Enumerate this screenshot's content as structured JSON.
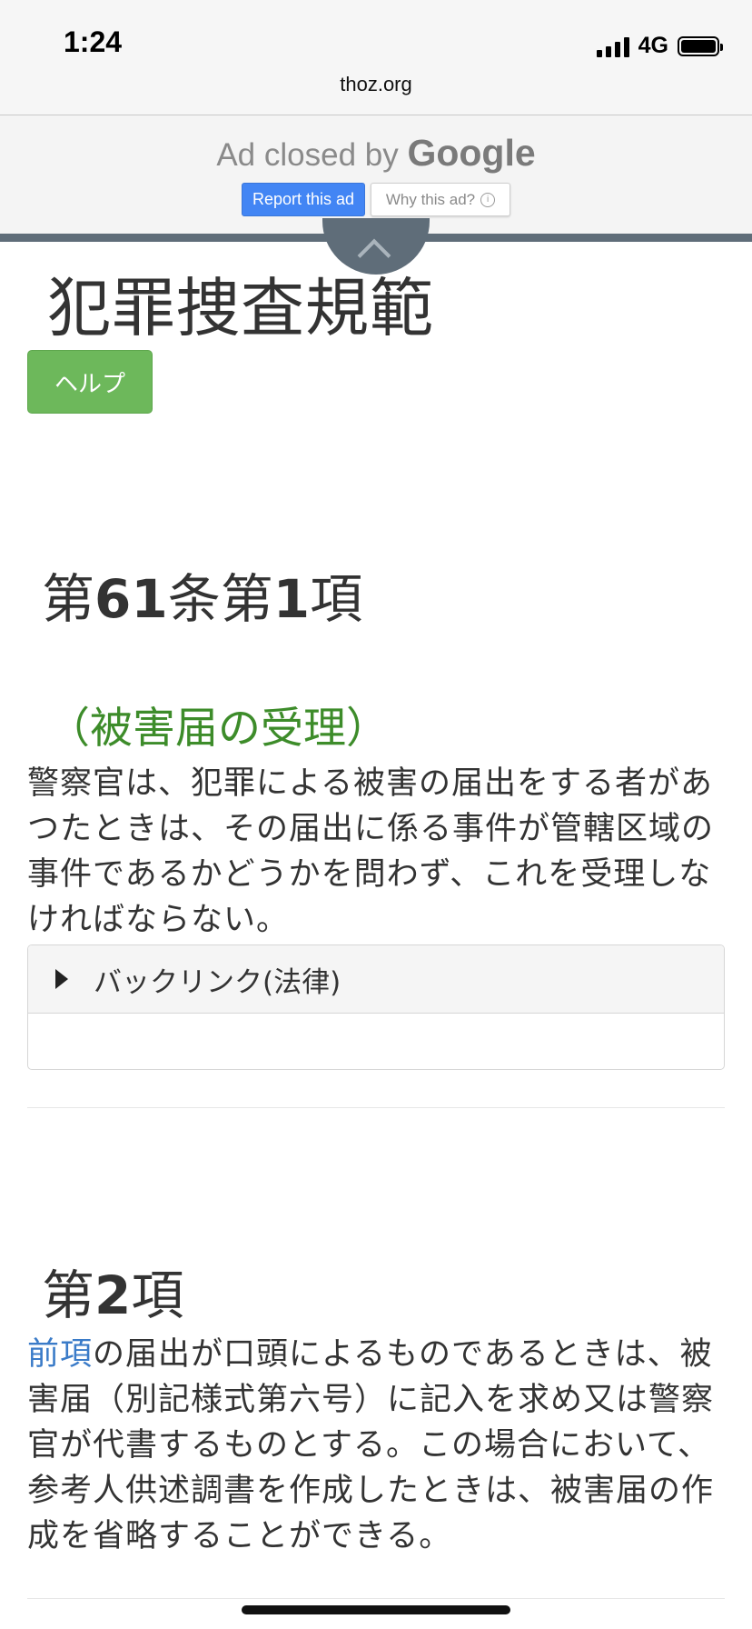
{
  "status_bar": {
    "time": "1:24",
    "network": "4G",
    "url": "thoz.org",
    "icons": [
      "signal-icon",
      "battery-icon"
    ]
  },
  "ad": {
    "closed_prefix": "Ad closed by ",
    "closed_brand": "Google",
    "report_label": "Report this ad",
    "why_label": "Why this ad?",
    "info_glyph": "i",
    "colors": {
      "report_bg": "#4285f4",
      "bar": "#5f6d79"
    }
  },
  "page": {
    "title": "犯罪捜査規範",
    "help_label": "ヘルプ"
  },
  "article": {
    "heading_prefix": "第",
    "heading_article_num": "61",
    "heading_mid": "条第",
    "heading_clause_num": "1",
    "heading_suffix": "項",
    "caption": "（被害届の受理）",
    "text": "警察官は、犯罪による被害の届出をする者があつたときは、その届出に係る事件が管轄区域の事件であるかどうかを問わず、これを受理しなければならない。",
    "backlink_label": "バックリンク(法律)"
  },
  "clause2": {
    "heading_prefix": "第",
    "heading_num": "2",
    "heading_suffix": "項",
    "link_text": "前項",
    "text": "の届出が口頭によるものであるときは、被害届（別記様式第六号）に記入を求め又は警察官が代書するものとする。この場合において、参考人供述調書を作成したときは、被害届の作成を省略することができる。"
  },
  "colors": {
    "help_button": "#6db85b",
    "caption": "#3d8c2a",
    "link": "#3a7bc8"
  }
}
